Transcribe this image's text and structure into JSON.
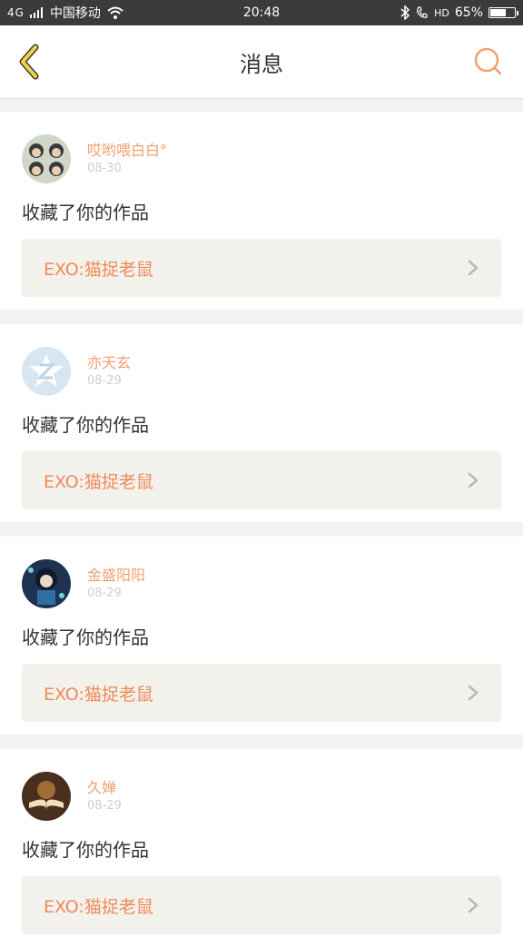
{
  "status_bar": {
    "network": "4G",
    "carrier": "中国移动",
    "time": "20:48",
    "hd": "HD",
    "battery": "65%",
    "battery_level": 0.65
  },
  "header": {
    "title": "消息"
  },
  "messages": [
    {
      "username": "哎哟喂白白°",
      "date": "08-30",
      "action": "收藏了你的作品",
      "work_title": "EXO:猫捉老鼠"
    },
    {
      "username": "亦天玄",
      "date": "08-29",
      "action": "收藏了你的作品",
      "work_title": "EXO:猫捉老鼠"
    },
    {
      "username": "金盛阳阳",
      "date": "08-29",
      "action": "收藏了你的作品",
      "work_title": "EXO:猫捉老鼠"
    },
    {
      "username": "久婵",
      "date": "08-29",
      "action": "收藏了你的作品",
      "work_title": "EXO:猫捉老鼠"
    }
  ],
  "colors": {
    "accent": "#f0a070",
    "work_text": "#f08a5a",
    "back_icon": "#f2d24a"
  }
}
